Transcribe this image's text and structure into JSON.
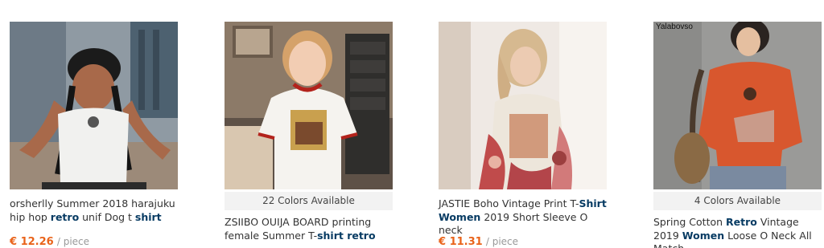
{
  "products": [
    {
      "title_parts": [
        "orsherlly Summer 2018 harajuku hip hop ",
        "retro",
        " unif Dog t ",
        "shirt"
      ],
      "price": "€ 12.26",
      "unit": "/ piece"
    },
    {
      "colors_available": "22 Colors Available",
      "title_parts": [
        "ZSIIBO OUIJA BOARD printing female Summer T-",
        "shirt retro"
      ]
    },
    {
      "title_parts": [
        "JASTIE Boho Vintage Print T-",
        "Shirt",
        " ",
        "Women",
        " 2019 Short Sleeve O neck"
      ],
      "price": "€ 11.31",
      "unit": "/ piece"
    },
    {
      "brand_watermark": "Yalabovso",
      "colors_available": "4 Colors Available",
      "title_parts": [
        "Spring Cotton ",
        "Retro",
        " Vintage 2019 ",
        "Women",
        " Loose O Neck All Match"
      ]
    }
  ]
}
